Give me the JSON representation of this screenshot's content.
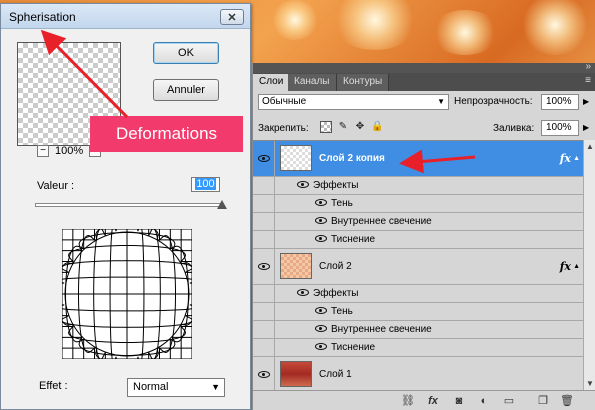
{
  "dialog": {
    "title": "Spherisation",
    "close_label": "✕",
    "ok_label": "OK",
    "cancel_label": "Annuler",
    "zoom_minus": "−",
    "zoom_plus": "+",
    "zoom_value": "100%",
    "valeur_label": "Valeur :",
    "valeur_value": "100",
    "valeur_percent": 100,
    "effet_label": "Effet :",
    "effet_value": "Normal"
  },
  "callout": {
    "text": "Deformations"
  },
  "layers_panel": {
    "tabs": [
      "Слои",
      "Каналы",
      "Контуры"
    ],
    "active_tab": "Слои",
    "menu_icon": "≡",
    "blend_mode": "Обычные",
    "opacity_label": "Непрозрачность:",
    "opacity_value": "100%",
    "lock_label": "Закрепить:",
    "fill_label": "Заливка:",
    "fill_value": "100%",
    "rows": [
      {
        "type": "layer",
        "name": "Слой 2 копия",
        "selected": true,
        "thumb": "checker",
        "fx": "fx"
      },
      {
        "type": "effect",
        "label": "Эффекты",
        "level": 1
      },
      {
        "type": "effect",
        "label": "Тень",
        "level": 2
      },
      {
        "type": "effect",
        "label": "Внутреннее свечение",
        "level": 2
      },
      {
        "type": "effect",
        "label": "Тиснение",
        "level": 2
      },
      {
        "type": "layer",
        "name": "Слой 2",
        "selected": false,
        "thumb": "checker-orange",
        "fx": "fx"
      },
      {
        "type": "effect",
        "label": "Эффекты",
        "level": 1
      },
      {
        "type": "effect",
        "label": "Тень",
        "level": 2
      },
      {
        "type": "effect",
        "label": "Внутреннее свечение",
        "level": 2
      },
      {
        "type": "effect",
        "label": "Тиснение",
        "level": 2
      },
      {
        "type": "layer",
        "name": "Слой 1",
        "selected": false,
        "thumb": "red",
        "fx": ""
      }
    ],
    "bottom_icons": [
      "link-icon",
      "fx-icon",
      "mask-icon",
      "adjustment-icon",
      "folder-icon",
      "new-layer-icon",
      "trash-icon"
    ]
  },
  "colors": {
    "selected_row": "#3f8ee3",
    "callout_bg": "#f23a6c",
    "arrow": "#e8202a"
  }
}
